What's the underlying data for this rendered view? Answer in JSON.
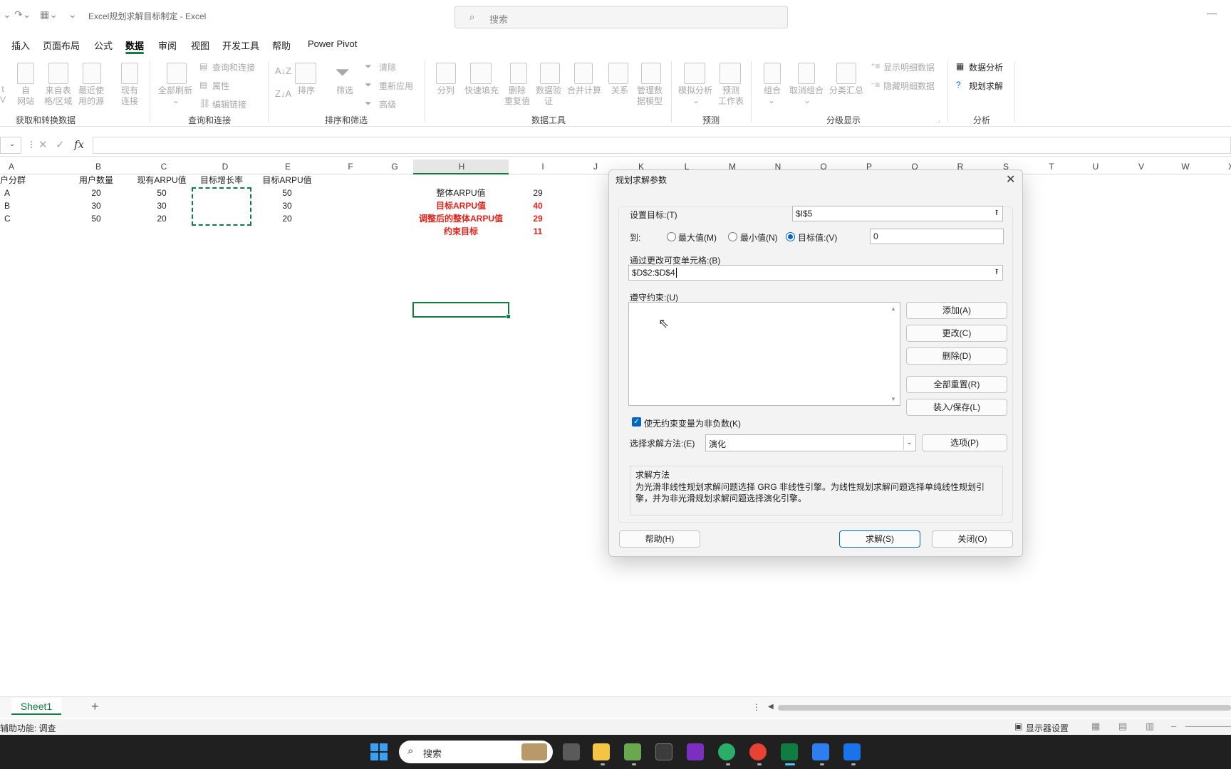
{
  "title_bar": {
    "title": "Excel规划求解目标制定  -  Excel",
    "search_placeholder": "搜索"
  },
  "menu": {
    "tabs": [
      "插入",
      "页面布局",
      "公式",
      "数据",
      "审阅",
      "视图",
      "开发工具",
      "帮助",
      "Power Pivot"
    ],
    "active": "数据"
  },
  "ribbon": {
    "get_transform": {
      "label": "获取和转换数据",
      "btn1": "自\n网站",
      "btn2": "来自表\n格/区域",
      "btn3": "最近使\n用的源",
      "btn4": "现有\n连接",
      "partial": "t\nV"
    },
    "queries": {
      "label": "查询和连接",
      "refresh_all": "全部刷新",
      "queries_connections": "查询和连接",
      "properties": "属性",
      "edit_links": "编辑链接"
    },
    "sort_filter": {
      "label": "排序和筛选",
      "sort": "排序",
      "filter": "筛选",
      "clear": "清除",
      "reapply": "重新应用",
      "advanced": "高级"
    },
    "data_tools": {
      "label": "数据工具",
      "split": "分列",
      "flash_fill": "快速填充",
      "remove_dup": "删除\n重复值",
      "validation": "数据验\n证",
      "consolidate": "合并计算",
      "relations": "关系",
      "data_model": "管理数\n据模型"
    },
    "forecast": {
      "label": "预测",
      "whatif": "模拟分析",
      "forecast_sheet": "预测\n工作表"
    },
    "outline": {
      "label": "分级显示",
      "group": "组合",
      "ungroup": "取消组合",
      "subtotal": "分类汇总",
      "show_detail": "显示明细数据",
      "hide_detail": "隐藏明细数据"
    },
    "analysis": {
      "label": "分析",
      "data_analysis": "数据分析",
      "solver": "规划求解"
    }
  },
  "formula_bar": {
    "fx": "fx"
  },
  "columns": [
    "A",
    "B",
    "C",
    "D",
    "E",
    "F",
    "G",
    "H",
    "I",
    "J",
    "K",
    "L",
    "M",
    "N",
    "O",
    "P",
    "Q",
    "R",
    "S",
    "T",
    "U",
    "V",
    "W",
    "X"
  ],
  "table": {
    "headers": [
      "户分群",
      "用户数量",
      "现有ARPU值",
      "目标增长率",
      "目标ARPU值"
    ],
    "rows": [
      [
        "A",
        "20",
        "50",
        "",
        "50"
      ],
      [
        "B",
        "30",
        "30",
        "",
        "30"
      ],
      [
        "C",
        "50",
        "20",
        "",
        "20"
      ]
    ]
  },
  "summary": [
    {
      "label": "整体ARPU值",
      "value": "29",
      "red": false
    },
    {
      "label": "目标ARPU值",
      "value": "40",
      "red": true
    },
    {
      "label": "调整后的整体ARPU值",
      "value": "29",
      "red": true
    },
    {
      "label": "约束目标",
      "value": "11",
      "red": true
    }
  ],
  "solver_dialog": {
    "title": "规划求解参数",
    "objective_label": "设置目标:(T)",
    "objective_value": "$I$5",
    "to_label": "到:",
    "opt_max": "最大值(M)",
    "opt_min": "最小值(N)",
    "opt_value": "目标值:(V)",
    "target_value": "0",
    "changing_label": "通过更改可变单元格:(B)",
    "changing_value": "$D$2:$D$4",
    "constraints_label": "遵守约束:(U)",
    "btn_add": "添加(A)",
    "btn_change": "更改(C)",
    "btn_delete": "删除(D)",
    "btn_reset": "全部重置(R)",
    "btn_load_save": "装入/保存(L)",
    "nonneg_label": "使无约束变量为非负数(K)",
    "method_label": "选择求解方法:(E)",
    "method_value": "演化",
    "btn_options": "选项(P)",
    "method_title": "求解方法",
    "method_desc": "为光滑非线性规划求解问题选择 GRG 非线性引擎。为线性规划求解问题选择单纯线性规划引擎，并为非光滑规划求解问题选择演化引擎。",
    "btn_help": "帮助(H)",
    "btn_solve": "求解(S)",
    "btn_close": "关闭(O)"
  },
  "sheets": {
    "tab1": "Sheet1"
  },
  "status": {
    "left": "辅助功能: 调查",
    "display_settings": "显示器设置"
  },
  "taskbar": {
    "search": "搜索"
  },
  "colors": {
    "excel_green": "#107c41",
    "red": "#e0241b",
    "accent": "#0067c0"
  }
}
